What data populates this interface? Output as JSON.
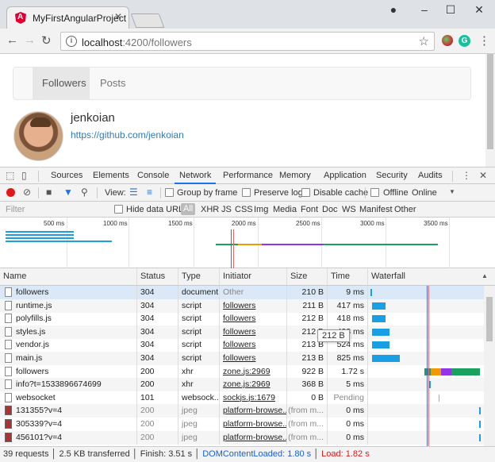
{
  "browser": {
    "tab_title": "MyFirstAngularProject",
    "url_host": "localhost",
    "url_rest": ":4200/followers"
  },
  "page": {
    "nav": [
      "Followers",
      "Posts"
    ],
    "active_nav": "Followers",
    "follower": {
      "name": "jenkoian",
      "profile_url": "https://github.com/jenkoian"
    }
  },
  "devtools": {
    "tabs": [
      "Sources",
      "Elements",
      "Console",
      "Network",
      "Performance",
      "Memory",
      "Application",
      "Security",
      "Audits"
    ],
    "active_tab": "Network",
    "toolbar": {
      "view_label": "View:",
      "group_by_frame": "Group by frame",
      "preserve_log": "Preserve log",
      "disable_cache": "Disable cache",
      "offline": "Offline",
      "throttle": "Online"
    },
    "filter": {
      "placeholder": "Filter",
      "hide_data_urls": "Hide data URLs",
      "types": [
        "All",
        "XHR",
        "JS",
        "CSS",
        "Img",
        "Media",
        "Font",
        "Doc",
        "WS",
        "Manifest",
        "Other"
      ],
      "active_type": "All"
    },
    "overview_ticks": [
      "500 ms",
      "1000 ms",
      "1500 ms",
      "2000 ms",
      "2500 ms",
      "3000 ms",
      "3500 ms"
    ],
    "columns": [
      "Name",
      "Status",
      "Type",
      "Initiator",
      "Size",
      "Time",
      "Waterfall"
    ],
    "rows": [
      {
        "name": "followers",
        "status": "304",
        "type": "document",
        "initiator": "Other",
        "size": "210 B",
        "time": "9 ms",
        "img": false
      },
      {
        "name": "runtime.js",
        "status": "304",
        "type": "script",
        "initiator": "followers",
        "size": "211 B",
        "time": "417 ms",
        "img": false
      },
      {
        "name": "polyfills.js",
        "status": "304",
        "type": "script",
        "initiator": "followers",
        "size": "212 B",
        "time": "418 ms",
        "img": false
      },
      {
        "name": "styles.js",
        "status": "304",
        "type": "script",
        "initiator": "followers",
        "size": "212 B",
        "time": "423 ms",
        "img": false
      },
      {
        "name": "vendor.js",
        "status": "304",
        "type": "script",
        "initiator": "followers",
        "size": "213 B",
        "time": "524 ms",
        "img": false
      },
      {
        "name": "main.js",
        "status": "304",
        "type": "script",
        "initiator": "followers",
        "size": "213 B",
        "time": "825 ms",
        "img": false
      },
      {
        "name": "followers",
        "status": "200",
        "type": "xhr",
        "initiator": "zone.js:2969",
        "size": "922 B",
        "time": "1.72 s",
        "img": false
      },
      {
        "name": "info?t=1533896674699",
        "status": "200",
        "type": "xhr",
        "initiator": "zone.js:2969",
        "size": "368 B",
        "time": "5 ms",
        "img": false
      },
      {
        "name": "websocket",
        "status": "101",
        "type": "websock...",
        "initiator": "sockjs.js:1679",
        "size": "0 B",
        "time": "Pending",
        "img": false
      },
      {
        "name": "131355?v=4",
        "status": "200",
        "type": "jpeg",
        "initiator": "platform-browse...",
        "size": "(from m...",
        "time": "0 ms",
        "img": true
      },
      {
        "name": "305339?v=4",
        "status": "200",
        "type": "jpeg",
        "initiator": "platform-browse...",
        "size": "(from m...",
        "time": "0 ms",
        "img": true
      },
      {
        "name": "456101?v=4",
        "status": "200",
        "type": "jpeg",
        "initiator": "platform-browse...",
        "size": "(from m...",
        "time": "0 ms",
        "img": true
      }
    ],
    "tooltip": "212 B",
    "status": {
      "requests": "39 requests",
      "transferred": "2.5 KB transferred",
      "finish": "Finish: 3.51 s",
      "dcl": "DOMContentLoaded: 1.80 s",
      "load": "Load: 1.82 s"
    }
  },
  "colors": {
    "accent": "#1a73e8",
    "angular_red": "#dd0031",
    "record_red": "#e0181a",
    "bar_blue": "#1a9fe5",
    "dcl_blue": "#1a5fd4",
    "load_red": "#d21d1d"
  }
}
